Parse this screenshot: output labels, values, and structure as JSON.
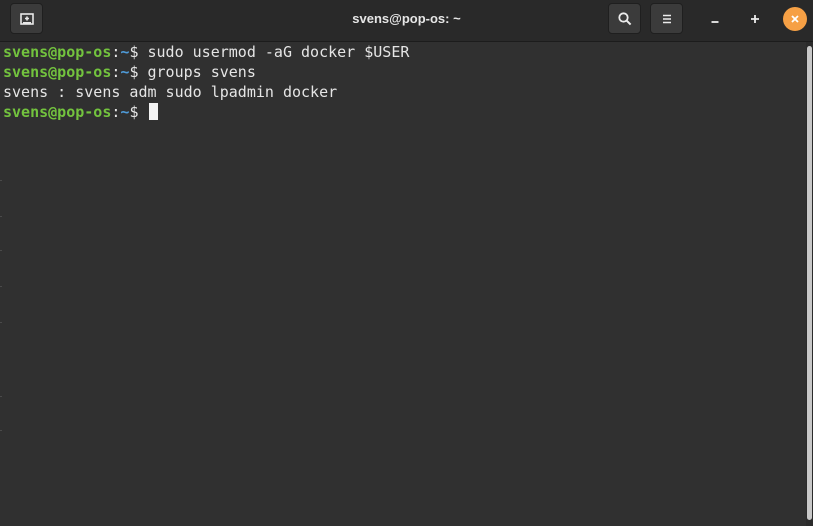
{
  "window": {
    "title": "svens@pop-os: ~"
  },
  "toolbar": {
    "new_tab_icon": "new-tab-icon",
    "search_icon": "search-icon",
    "menu_icon": "hamburger-menu-icon",
    "minimize_icon": "minimize-icon",
    "maximize_icon": "maximize-icon",
    "close_icon": "close-icon",
    "close_color": "#f6a045"
  },
  "terminal": {
    "colors": {
      "prompt_user": "#73c33e",
      "prompt_path": "#4f9bd8",
      "text": "#e5e5e5",
      "background": "#303030"
    },
    "lines": [
      {
        "user": "svens@pop-os",
        "sep": ":",
        "path": "~",
        "dollar": "$",
        "command": " sudo usermod -aG docker $USER"
      },
      {
        "user": "svens@pop-os",
        "sep": ":",
        "path": "~",
        "dollar": "$",
        "command": " groups svens"
      },
      {
        "output": "svens : svens adm sudo lpadmin docker"
      },
      {
        "user": "svens@pop-os",
        "sep": ":",
        "path": "~",
        "dollar": "$",
        "command": " "
      }
    ]
  }
}
